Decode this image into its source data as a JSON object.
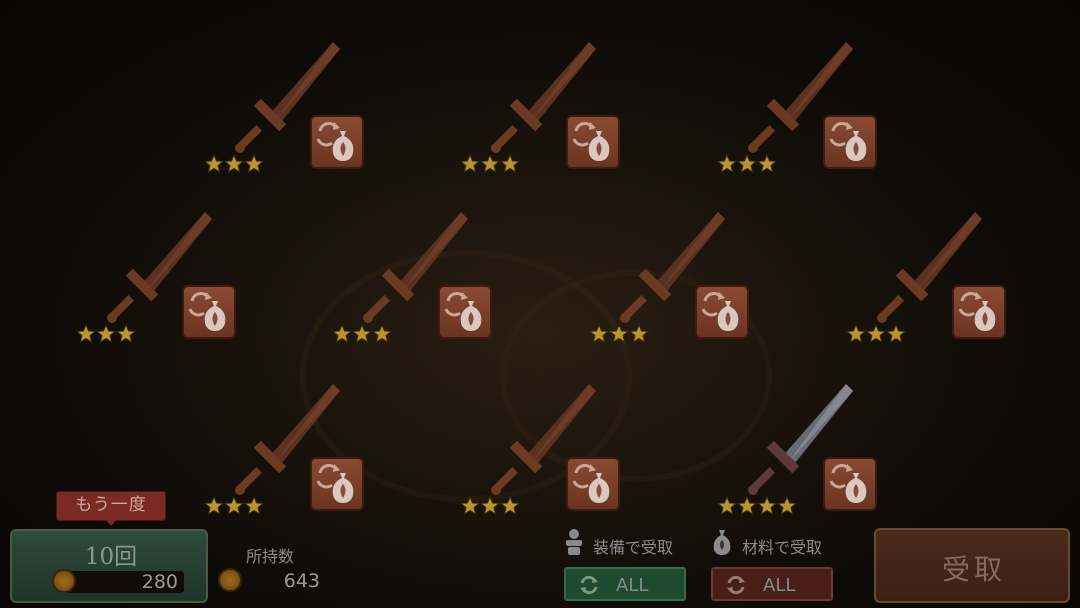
{
  "items": [
    {
      "stars": 3,
      "sword": "wooden",
      "convert_icon": "convert-to-material-icon"
    },
    {
      "stars": 3,
      "sword": "wooden",
      "convert_icon": "convert-to-material-icon"
    },
    {
      "stars": 3,
      "sword": "wooden",
      "convert_icon": "convert-to-material-icon"
    },
    {
      "stars": 3,
      "sword": "wooden",
      "convert_icon": "convert-to-material-icon"
    },
    {
      "stars": 3,
      "sword": "wooden",
      "convert_icon": "convert-to-material-icon"
    },
    {
      "stars": 3,
      "sword": "wooden",
      "convert_icon": "convert-to-material-icon"
    },
    {
      "stars": 3,
      "sword": "wooden",
      "convert_icon": "convert-to-material-icon"
    },
    {
      "stars": 3,
      "sword": "wooden",
      "convert_icon": "convert-to-material-icon"
    },
    {
      "stars": 3,
      "sword": "wooden",
      "convert_icon": "convert-to-material-icon"
    },
    {
      "stars": 4,
      "sword": "steel",
      "convert_icon": "convert-to-material-icon"
    }
  ],
  "retry": {
    "tag": "もう一度",
    "count_label": "10回",
    "cost": "280"
  },
  "owned": {
    "label": "所持数",
    "amount": "643"
  },
  "equip_receive": {
    "label": "装備で受取",
    "button": "ALL"
  },
  "material_receive": {
    "label": "材料で受取",
    "button": "ALL"
  },
  "receive_button": "受取",
  "colors": {
    "star": "#b8962e",
    "equip_all_bg": "#1e4a30",
    "material_all_bg": "#4a1e18"
  }
}
